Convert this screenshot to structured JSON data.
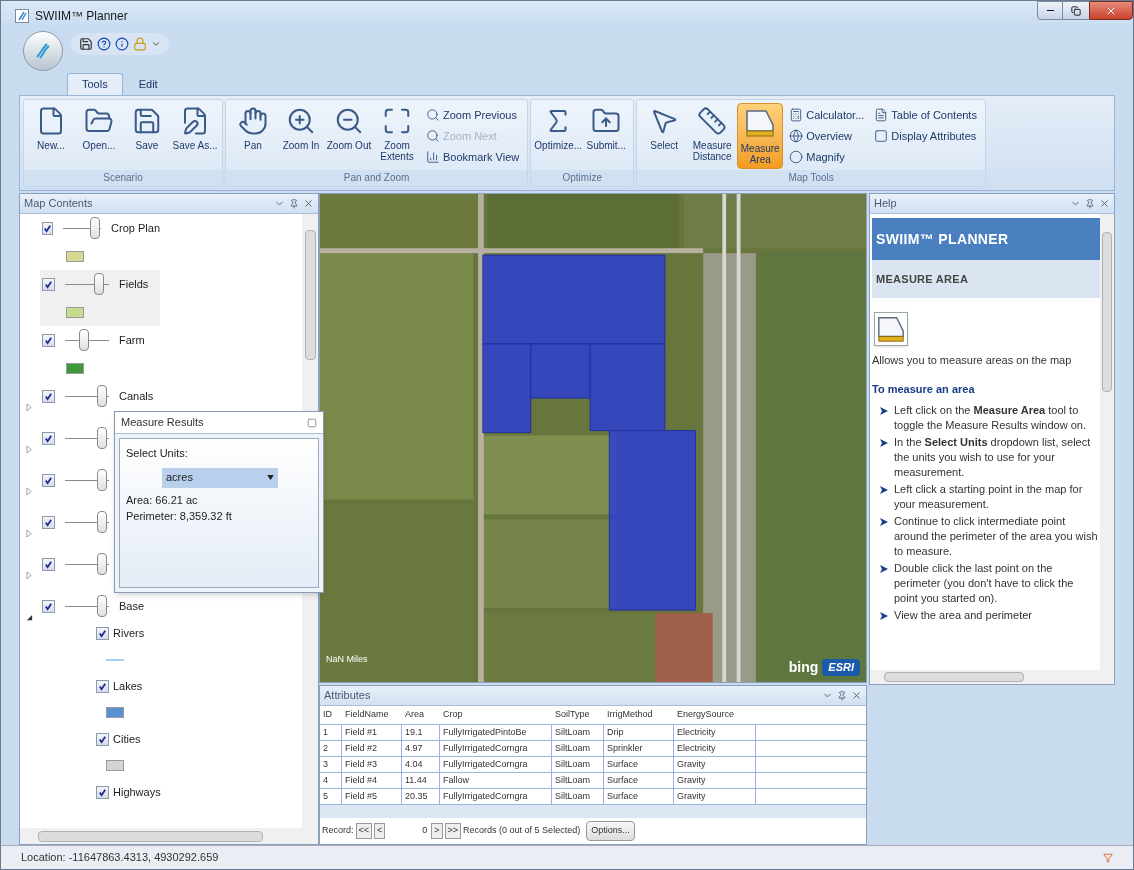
{
  "window": {
    "title": "SWIIM™ Planner"
  },
  "ribbon": {
    "tabs": [
      {
        "label": "Tools",
        "selected": true
      },
      {
        "label": "Edit",
        "selected": false
      }
    ],
    "groups": [
      {
        "label": "Scenario",
        "buttons": [
          {
            "label": "New...",
            "kind": "large",
            "selected": false,
            "disabled": false
          },
          {
            "label": "Open...",
            "kind": "large",
            "selected": false,
            "disabled": false
          },
          {
            "label": "Save",
            "kind": "large",
            "selected": false,
            "disabled": false
          },
          {
            "label": "Save As...",
            "kind": "large",
            "selected": false,
            "disabled": false
          }
        ]
      },
      {
        "label": "Pan and Zoom",
        "buttons": [
          {
            "label": "Pan",
            "kind": "large",
            "selected": false,
            "disabled": false
          },
          {
            "label": "Zoom In",
            "kind": "large",
            "selected": false,
            "disabled": false
          },
          {
            "label": "Zoom Out",
            "kind": "large",
            "selected": false,
            "disabled": false
          },
          {
            "label": "Zoom Extents",
            "kind": "large",
            "selected": false,
            "disabled": false
          },
          {
            "label": "Zoom Previous",
            "kind": "small",
            "selected": false,
            "disabled": false
          },
          {
            "label": "Zoom Next",
            "kind": "small",
            "selected": false,
            "disabled": true
          },
          {
            "label": "Bookmark View",
            "kind": "small",
            "selected": false,
            "disabled": false
          }
        ]
      },
      {
        "label": "Optimize",
        "buttons": [
          {
            "label": "Optimize...",
            "kind": "large",
            "selected": false,
            "disabled": false
          },
          {
            "label": "Submit...",
            "kind": "large",
            "selected": false,
            "disabled": false
          }
        ]
      },
      {
        "label": "Map Tools",
        "buttons": [
          {
            "label": "Select",
            "kind": "large",
            "selected": false,
            "disabled": false
          },
          {
            "label": "Measure Distance",
            "kind": "large",
            "selected": false,
            "disabled": false
          },
          {
            "label": "Measure Area",
            "kind": "large",
            "selected": true,
            "disabled": false
          },
          {
            "label": "Calculator...",
            "kind": "small",
            "selected": false,
            "disabled": false
          },
          {
            "label": "Overview",
            "kind": "small",
            "selected": false,
            "disabled": false
          },
          {
            "label": "Magnify",
            "kind": "small",
            "selected": false,
            "disabled": false
          },
          {
            "label": "Table of Contents",
            "kind": "small",
            "selected": false,
            "disabled": false
          },
          {
            "label": "Display Attributes",
            "kind": "small",
            "selected": false,
            "disabled": false
          }
        ]
      }
    ]
  },
  "map_contents": {
    "title": "Map Contents",
    "layers": [
      {
        "name": "Crop Plan",
        "checked": true,
        "level": 0.95,
        "selected": false,
        "color": "#d8d890"
      },
      {
        "name": "Fields",
        "checked": true,
        "level": 0.85,
        "selected": true,
        "color": "#c4dc8c"
      },
      {
        "name": "Farm",
        "checked": true,
        "level": 0.4,
        "selected": false,
        "color": "#3c9a3c"
      },
      {
        "name": "Canals",
        "checked": true,
        "level": 0.95,
        "selected": false,
        "expanded": false
      },
      {
        "checked": true,
        "level": 0.95,
        "selected": false,
        "expanded": false
      },
      {
        "checked": true,
        "level": 0.95,
        "selected": false,
        "expanded": false
      },
      {
        "checked": true,
        "level": 0.95,
        "selected": false,
        "expanded": false
      },
      {
        "checked": true,
        "level": 0.95,
        "selected": false,
        "expanded": false
      },
      {
        "name": "Base",
        "checked": true,
        "level": 0.95,
        "selected": false,
        "expanded": true,
        "children": [
          {
            "name": "Rivers",
            "checked": true,
            "kind": "line",
            "color": "#a8d0f0"
          },
          {
            "name": "Lakes",
            "checked": true,
            "kind": "fill",
            "color": "#5b8fd6"
          },
          {
            "name": "Cities",
            "checked": true,
            "kind": "fill",
            "color": "#d4d4d4"
          },
          {
            "name": "Highways",
            "checked": true
          }
        ]
      }
    ]
  },
  "measure_results": {
    "title": "Measure Results",
    "units_label": "Select Units:",
    "units": "acres",
    "area": "Area: 66.21 ac",
    "perimeter": "Perimeter: 8,359.32 ft"
  },
  "map": {
    "scale": "NaN Miles",
    "logos": [
      "bing",
      "ESRI"
    ]
  },
  "help": {
    "title": "Help",
    "heading": "SWIIM™ PLANNER",
    "subheading": "MEASURE AREA",
    "description": "Allows you to measure areas on the map",
    "section": "To measure an area",
    "steps": [
      "Left click on the **Measure Area** tool to toggle the Measure Results window on.",
      "In the **Select Units** dropdown list, select the units you wish to use for your measurement.",
      "Left click a starting point in the map for your measurement.",
      "Continue to click intermediate point around the perimeter of the area you wish to measure.",
      "Double click the last point on the perimeter (you don't have to click the point you started on).",
      "View the area and perimeter"
    ]
  },
  "attributes": {
    "title": "Attributes",
    "columns": [
      "ID",
      "FieldName",
      "Area",
      "Crop",
      "SoilType",
      "IrrigMethod",
      "EnergySource"
    ],
    "rows": [
      [
        "1",
        "Field #1",
        "19.1",
        "FullyIrrigatedPintoBe",
        "SiltLoam",
        "Drip",
        "Electricity"
      ],
      [
        "2",
        "Field #2",
        "4.97",
        "FullyIrrigatedCorngra",
        "SiltLoam",
        "Sprinkler",
        "Electricity"
      ],
      [
        "3",
        "Field #3",
        "4.04",
        "FullyIrrigatedCorngra",
        "SiltLoam",
        "Surface",
        "Gravity"
      ],
      [
        "4",
        "Field #4",
        "11.44",
        "Fallow",
        "SiltLoam",
        "Surface",
        "Gravity"
      ],
      [
        "5",
        "Field #5",
        "20.35",
        "FullyIrrigatedCorngra",
        "SiltLoam",
        "Surface",
        "Gravity"
      ]
    ],
    "pager": {
      "label": "Record:",
      "first": "<<",
      "prev": "<",
      "record": "0",
      "next": ">",
      "last": ">>",
      "summary": "Records (0 out of 5 Selected)",
      "options": "Options..."
    }
  },
  "status_bar": {
    "location": "Location: -11647863.4313, 4930292.659"
  }
}
